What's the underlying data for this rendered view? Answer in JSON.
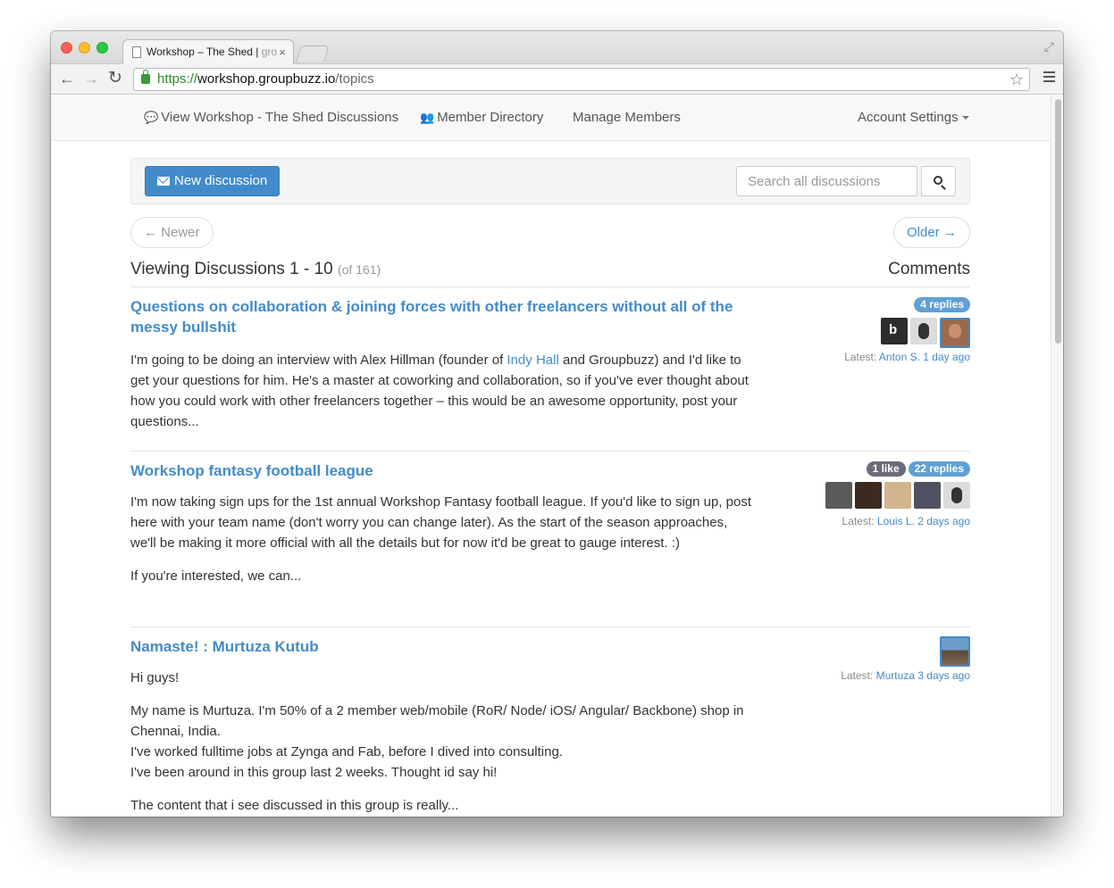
{
  "browser": {
    "tab_title": "Workshop – The Shed | ",
    "tab_title_fade": "gro",
    "url_scheme": "https://",
    "url_host": "workshop.groupbuzz.io",
    "url_path": "/topics"
  },
  "nav": {
    "discussions": "View Workshop - The Shed Discussions",
    "members": "Member Directory",
    "manage": "Manage Members",
    "account": "Account Settings"
  },
  "actions": {
    "new_discussion": "New discussion",
    "search_placeholder": "Search all discussions"
  },
  "pager": {
    "newer": "← Newer",
    "older": "Older →"
  },
  "list": {
    "heading": "Viewing Discussions 1 - 10",
    "count": "(of 161)",
    "comments_heading": "Comments"
  },
  "topics": [
    {
      "title": "Questions on collaboration & joining forces with other freelancers without all of the messy bullshit",
      "body_pre": "I'm going to be doing an interview with Alex Hillman (founder of ",
      "body_link": "Indy Hall",
      "body_post": " and Groupbuzz) and I'd like to get your questions for him. He's a master at coworking and collaboration, so if you've ever thought about how you could work with other freelancers together – this would be an awesome opportunity, post your questions...",
      "likes": "",
      "replies": "4 replies",
      "latest_label": "Latest:",
      "latest_user": "Anton S.",
      "latest_time": "1 day ago",
      "avatar_colors": [
        "#2d2d2d",
        "#dcdcdc",
        "#9a6a4d"
      ]
    },
    {
      "title": "Workshop fantasy football league",
      "body_p1": "I'm now taking sign ups for the 1st annual Workshop Fantasy football league. If you'd like to sign up, post here with your team name (don't worry you can change later). As the start of the season approaches, we'll be making it more official with all the details but for now it'd be great to gauge interest. :)",
      "body_p2": "If you're interested, we can...",
      "likes": "1 like",
      "replies": "22 replies",
      "latest_label": "Latest:",
      "latest_user": "Louis L.",
      "latest_time": "2 days ago",
      "avatar_colors": [
        "#5a5a5a",
        "#3b2a1f",
        "#d2b48c",
        "#4f5163",
        "#dcdcdc"
      ]
    },
    {
      "title": "Namaste! : Murtuza Kutub",
      "body_p1": "Hi guys!",
      "body_p2_l1": "My name is Murtuza. I'm 50% of a 2 member web/mobile (RoR/ Node/ iOS/ Angular/ Backbone) shop in Chennai, India.",
      "body_p2_l2": "I've worked fulltime jobs at Zynga and Fab, before I dived into consulting.",
      "body_p2_l3": "I've been around in this group last 2 weeks. Thought id say hi!",
      "body_p3": "The content that i see discussed in this group is really...",
      "latest_label": "Latest:",
      "latest_user": "Murtuza",
      "latest_time": "3 days ago",
      "avatar_colors": [
        "#5b7fa0"
      ]
    }
  ]
}
